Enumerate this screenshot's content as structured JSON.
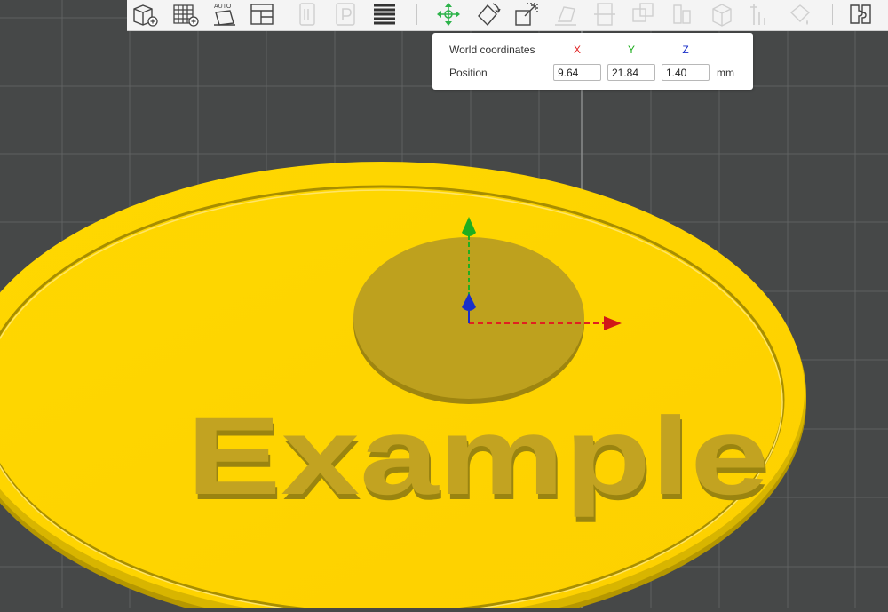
{
  "toolbar": {
    "icons": [
      "add-cube-icon",
      "arrange-grid-icon",
      "auto-orient-icon",
      "layout-icon",
      "placeholder-icon",
      "plate-p-icon",
      "layers-icon",
      "move-icon",
      "rotate-icon",
      "scale-icon",
      "lay-on-face-icon",
      "cut-icon",
      "boolean-icon",
      "support-paint-icon",
      "seam-icon",
      "measure-icon",
      "fill-icon",
      "assembly-icon"
    ]
  },
  "move_panel": {
    "heading": "World coordinates",
    "axis_x": "X",
    "axis_y": "Y",
    "axis_z": "Z",
    "row_label": "Position",
    "x_value": "9.64",
    "y_value": "21.84",
    "z_value": "1.40",
    "unit": "mm"
  },
  "scene": {
    "embossed_text": "Example",
    "colors": {
      "background": "#464848",
      "grid": "#5f6161",
      "grid_major": "#7a7c7c",
      "plate": "#FFD400",
      "plate_side": "#B89C00",
      "embossed": "#BEA11E",
      "axis_x": "#E02020",
      "axis_y": "#1FAE1F",
      "axis_z": "#1A2FC8"
    }
  }
}
